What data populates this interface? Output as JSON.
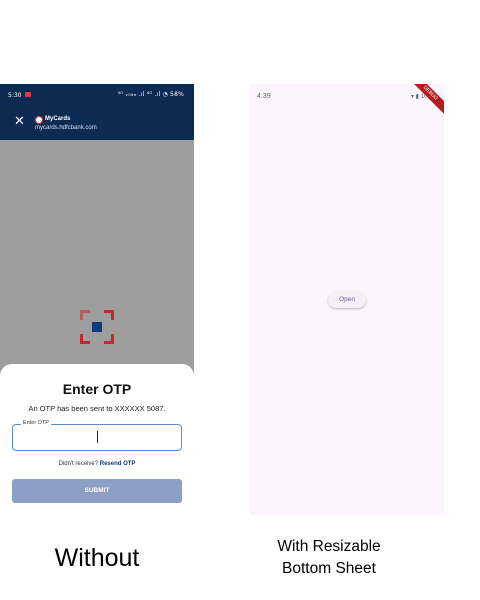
{
  "left": {
    "status_bar": {
      "time": "5:30",
      "signal": "⁴ᴳ ᵥ₀ₗₜₑ .ıl ⁴ᴳ .ıl ◔ 58%"
    },
    "app_bar": {
      "close_icon": "close-icon",
      "brand": "MyCards",
      "url": "mycards.hdfcbank.com"
    },
    "otp_sheet": {
      "title": "Enter OTP",
      "message": "An OTP has been sent to XXXXXX 5087.",
      "field_label": "Enter OTP",
      "field_value": "",
      "resend_prefix": "Didn't receive?",
      "resend_link": "Resend OTP",
      "submit_label": "SUBMIT"
    },
    "caption": "Without"
  },
  "right": {
    "status_bar": {
      "time": "4:39",
      "signal": "▾ ▮ 100%"
    },
    "debug_banner": "DEBUG",
    "open_button": "Open",
    "caption_line1": "With Resizable",
    "caption_line2": "Bottom Sheet"
  },
  "colors": {
    "brand_navy": "#0d2b52",
    "submit_disabled": "#8ba0c4",
    "accent_red": "#c62828",
    "right_background": "#fdf5fd"
  }
}
